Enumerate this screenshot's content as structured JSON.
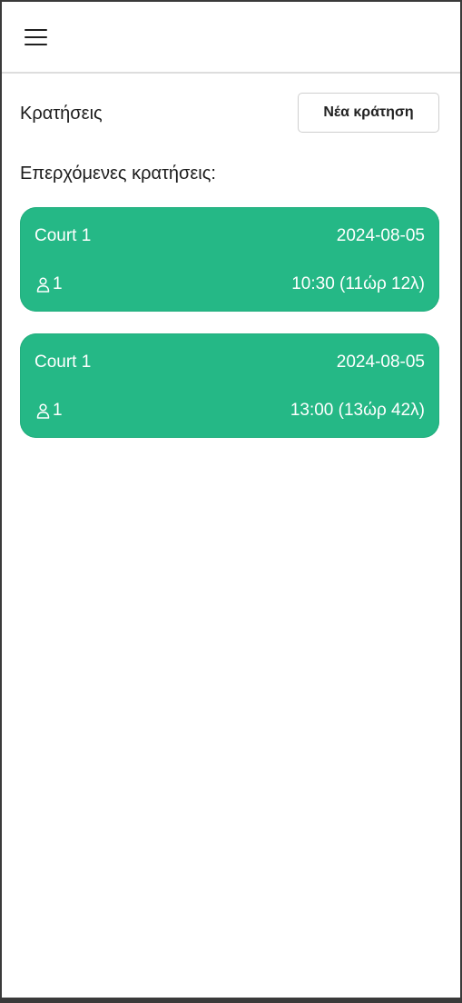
{
  "header": {
    "menu_icon": "hamburger-menu-icon"
  },
  "page": {
    "title": "Κρατήσεις",
    "new_booking_label": "Νέα κράτηση",
    "upcoming_label": "Επερχόμενες κρατήσεις:"
  },
  "colors": {
    "card_background": "#25b886",
    "card_text": "#ffffff"
  },
  "bookings": [
    {
      "court": "Court 1",
      "date": "2024-08-05",
      "people": "1",
      "people_icon": "person-icon",
      "time": "10:30 (11ώρ 12λ)"
    },
    {
      "court": "Court 1",
      "date": "2024-08-05",
      "people": "1",
      "people_icon": "person-icon",
      "time": "13:00 (13ώρ 42λ)"
    }
  ]
}
